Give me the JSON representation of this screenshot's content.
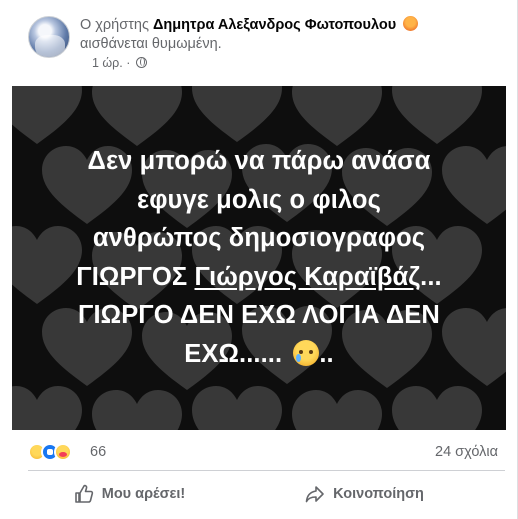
{
  "post": {
    "author_prefix": "Ο χρήστης",
    "author_name": "Δημητρα Αλεξανδρος Φωτοπουλου",
    "feeling_text": "αισθάνεται θυμωμένη.",
    "time_ago": "1 ώρ. ·",
    "privacy_icon": "globe-icon",
    "feeling_icon": "angry-face-icon"
  },
  "image_text": {
    "line1": "Δεν μπορώ να πάρω ανάσα",
    "line2": "εφυγε μολις ο φιλος",
    "line3": "ανθρώπος δημοσιογραφος",
    "line4_prefix": "ΓΙΩΡΓΟΣ",
    "line4_link": "Γιώργος Καραϊβάζ",
    "line4_suffix": "...",
    "line5": "ΓΙΩΡΓΟ ΔΕΝ ΕΧΩ ΛΟΓΙΑ ΔΕΝ",
    "line6": "ΕΧΩ......",
    "line6_suffix": "..",
    "emoji": "crying-face-icon"
  },
  "reactions": {
    "icons": [
      "sad-reaction-icon",
      "like-reaction-icon",
      "care-reaction-icon"
    ],
    "count": "66",
    "comments": "24 σχόλια"
  },
  "actions": {
    "like_label": "Μου αρέσει!",
    "share_label": "Κοινοποίηση"
  },
  "colors": {
    "link_blue": "#1877f2",
    "secondary_text": "#65676b",
    "image_bg": "#0e0e0e"
  }
}
